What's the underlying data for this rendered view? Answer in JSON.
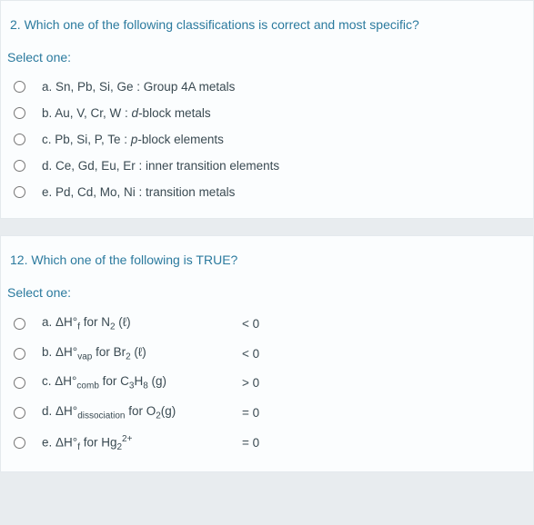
{
  "questions": [
    {
      "number": "2",
      "prompt": "Which one of the following classifications is correct and most specific?",
      "select_one": "Select one:",
      "options": [
        {
          "html": "a. Sn, Pb, Si, Ge : Group 4A metals"
        },
        {
          "html": "b. Au, V, Cr, W : <span class=\"italic\">d</span>-block metals"
        },
        {
          "html": "c. Pb, Si, P, Te : <span class=\"italic\">p</span>-block elements"
        },
        {
          "html": "d. Ce, Gd, Eu, Er : inner transition elements"
        },
        {
          "html": "e. Pd, Cd, Mo, Ni : transition metals"
        }
      ]
    },
    {
      "number": "12",
      "prompt": "Which one of the following is TRUE?",
      "select_one": "Select one:",
      "options": [
        {
          "html": "a. ΔH°<sub>f</sub> for N<sub>2</sub> (ℓ)",
          "col2": "< 0"
        },
        {
          "html": "b. ΔH°<sub>vap</sub> for Br<sub>2</sub> (ℓ)",
          "col2": "< 0"
        },
        {
          "html": "c. ΔH°<sub>comb</sub> for C<sub>3</sub>H<sub>8</sub> (g)",
          "col2": "> 0"
        },
        {
          "html": "d. ΔH°<sub>dissociation</sub> for O<sub>2</sub>(g)",
          "col2": "= 0"
        },
        {
          "html": "e. ΔH°<sub>f</sub> for Hg<sub>2</sub><sup>2+</sup>",
          "col2": "= 0"
        }
      ]
    }
  ]
}
